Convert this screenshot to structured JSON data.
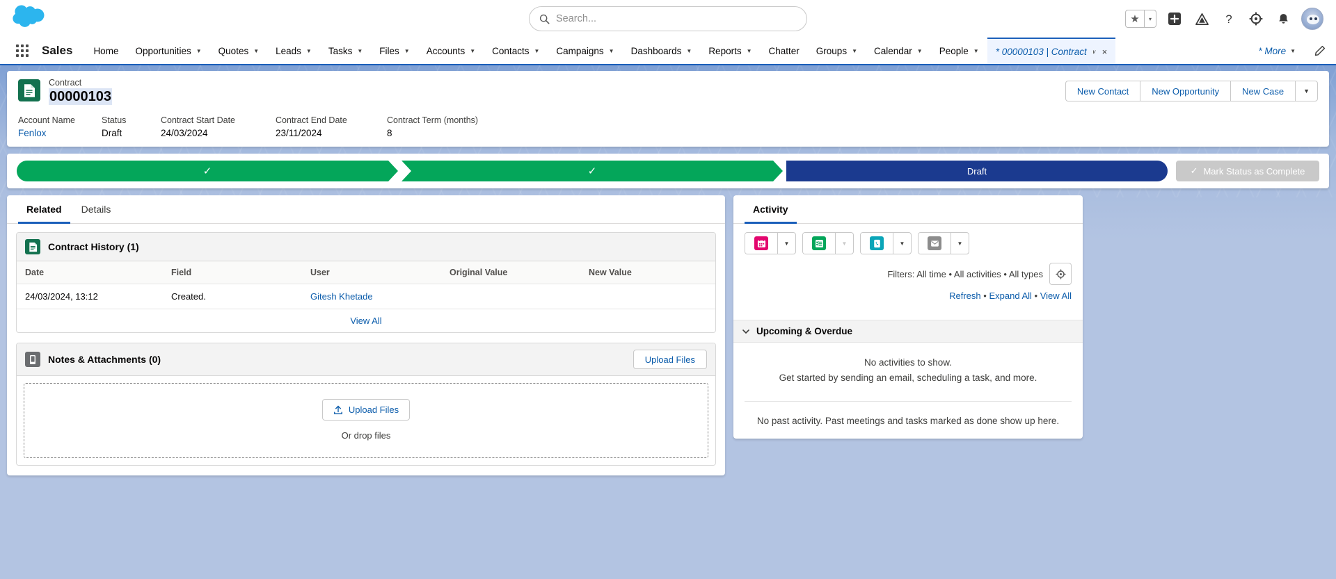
{
  "header": {
    "logo_name": "salesforce-cloud-logo",
    "search": {
      "placeholder": "Search...",
      "value": "",
      "icon": "search-icon"
    },
    "icons": [
      {
        "name": "favorites-star-icon",
        "glyph": "★"
      },
      {
        "name": "favorites-caret-icon",
        "glyph": "▾"
      },
      {
        "name": "global-actions-plus-icon",
        "glyph": "+"
      },
      {
        "name": "setup-assistant-icon",
        "glyph": "▲"
      },
      {
        "name": "help-icon",
        "glyph": "?"
      },
      {
        "name": "setup-gear-icon",
        "glyph": "⚙"
      },
      {
        "name": "notifications-bell-icon",
        "glyph": "🔔"
      },
      {
        "name": "user-avatar",
        "glyph": ""
      }
    ]
  },
  "appnav": {
    "app_name": "Sales",
    "waffle_icon": "app-launcher-icon",
    "items": [
      {
        "label": "Home",
        "caret": false
      },
      {
        "label": "Opportunities",
        "caret": true
      },
      {
        "label": "Quotes",
        "caret": true
      },
      {
        "label": "Leads",
        "caret": true
      },
      {
        "label": "Tasks",
        "caret": true
      },
      {
        "label": "Files",
        "caret": true
      },
      {
        "label": "Accounts",
        "caret": true
      },
      {
        "label": "Contacts",
        "caret": true
      },
      {
        "label": "Campaigns",
        "caret": true
      },
      {
        "label": "Dashboards",
        "caret": true
      },
      {
        "label": "Reports",
        "caret": true
      },
      {
        "label": "Chatter",
        "caret": false
      },
      {
        "label": "Groups",
        "caret": true
      },
      {
        "label": "Calendar",
        "caret": true
      },
      {
        "label": "People",
        "caret": true
      }
    ],
    "active_tab": {
      "label": "* 00000103 | Contract",
      "caret": "∨",
      "close": "×"
    },
    "more": {
      "label": "* More",
      "caret": "▼"
    },
    "edit_icon": "pencil-edit-icon"
  },
  "record": {
    "type_label": "Contract",
    "title": "00000103",
    "icon": "contract-document-icon",
    "actions": [
      {
        "label": "New Contact"
      },
      {
        "label": "New Opportunity"
      },
      {
        "label": "New Case"
      }
    ],
    "actions_caret": "▼",
    "fields": [
      {
        "label": "Account Name",
        "value": "Fenlox",
        "link": true
      },
      {
        "label": "Status",
        "value": "Draft",
        "link": false
      },
      {
        "label": "Contract Start Date",
        "value": "24/03/2024",
        "link": false
      },
      {
        "label": "Contract End Date",
        "value": "23/11/2024",
        "link": false
      },
      {
        "label": "Contract Term (months)",
        "value": "8",
        "link": false
      }
    ]
  },
  "path": {
    "stages": [
      {
        "label": "",
        "state": "complete",
        "check": "✓"
      },
      {
        "label": "",
        "state": "complete",
        "check": "✓"
      },
      {
        "label": "Draft",
        "state": "current",
        "check": ""
      }
    ],
    "mark_complete_label": "Mark Status as Complete",
    "mark_complete_check": "✓",
    "mark_complete_disabled": true,
    "colors": {
      "complete": "#04a65a",
      "current": "#1b3a8f",
      "disabled_button": "#c9c9c9"
    }
  },
  "left": {
    "tabs": [
      {
        "label": "Related",
        "active": true
      },
      {
        "label": "Details",
        "active": false
      }
    ],
    "contract_history": {
      "title": "Contract History (1)",
      "icon": "contract-history-icon",
      "columns": [
        "Date",
        "Field",
        "User",
        "Original Value",
        "New Value"
      ],
      "rows": [
        {
          "date": "24/03/2024, 13:12",
          "field": "Created.",
          "user": "Gitesh Khetade",
          "original_value": "",
          "new_value": ""
        }
      ],
      "view_all": "View All"
    },
    "notes_attachments": {
      "title": "Notes & Attachments (0)",
      "icon": "attachment-file-icon",
      "header_button": "Upload Files",
      "dropzone_button": "Upload Files",
      "dropzone_button_icon": "upload-icon",
      "drop_text": "Or drop files"
    }
  },
  "activity": {
    "tab_label": "Activity",
    "buttons": [
      {
        "name": "new-event-button",
        "icon": "calendar-event-icon",
        "color": "#e3066e",
        "caret_disabled": false
      },
      {
        "name": "new-task-button",
        "icon": "task-checklist-icon",
        "color": "#04a65a",
        "caret_disabled": true
      },
      {
        "name": "log-a-call-button",
        "icon": "phone-call-icon",
        "color": "#0d9dda",
        "caret_disabled": false
      },
      {
        "name": "email-button",
        "icon": "email-envelope-icon",
        "color": "#8c8c8c",
        "caret_disabled": false
      }
    ],
    "filters_text": "Filters: All time • All activities • All types",
    "filter_gear_icon": "filter-gear-icon",
    "links": [
      {
        "label": "Refresh"
      },
      {
        "label": "Expand All"
      },
      {
        "label": "View All"
      }
    ],
    "links_separator": "•",
    "section": {
      "label": "Upcoming & Overdue",
      "chevron_icon": "chevron-down-icon",
      "empty_line1": "No activities to show.",
      "empty_line2": "Get started by sending an email, scheduling a task, and more."
    },
    "past_message": "No past activity. Past meetings and tasks marked as done show up here."
  }
}
